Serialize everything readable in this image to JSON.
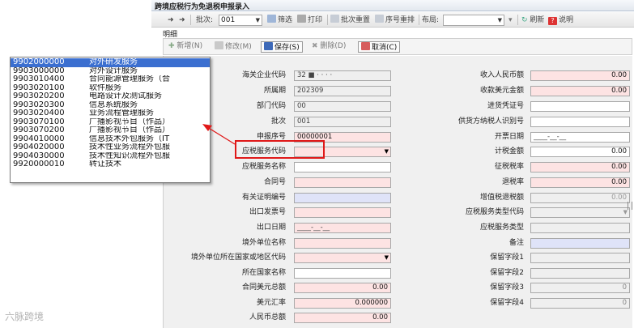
{
  "window": {
    "title": "跨境应税行为免退税申报录入"
  },
  "toolbar": {
    "batch_label": "批次:",
    "batch_value": "001",
    "filter": "筛选",
    "print": "打印",
    "batch_reset": "批次重置",
    "seq_reset": "序号重排",
    "layout_label": "布局:",
    "refresh": "刷新",
    "help": "说明"
  },
  "section": {
    "title": "明细"
  },
  "detail_toolbar": {
    "add": "新增(N)",
    "edit": "修改(M)",
    "save": "保存(S)",
    "delete": "删除(D)",
    "cancel": "取消(C)"
  },
  "left_fields": [
    {
      "label": "海关企业代码",
      "value": "32 ■ · · · ·"
    },
    {
      "label": "所属期",
      "value": "202309"
    },
    {
      "label": "部门代码",
      "value": "00"
    },
    {
      "label": "批次",
      "value": "001"
    },
    {
      "label": "申报序号",
      "value": "00000001"
    },
    {
      "label": "应税服务代码",
      "value": ""
    },
    {
      "label": "应税服务名称",
      "value": ""
    },
    {
      "label": "合同号",
      "value": ""
    },
    {
      "label": "有关证明编号",
      "value": ""
    },
    {
      "label": "出口发票号",
      "value": ""
    },
    {
      "label": "出口日期",
      "value": "____-__-__"
    },
    {
      "label": "境外单位名称",
      "value": ""
    },
    {
      "label": "境外单位所在国家或地区代码",
      "value": ""
    },
    {
      "label": "所在国家名称",
      "value": ""
    },
    {
      "label": "合同美元总额",
      "value": "0.00"
    },
    {
      "label": "美元汇率",
      "value": "0.000000"
    },
    {
      "label": "人民币总额",
      "value": "0.00"
    }
  ],
  "right_fields": [
    {
      "label": "收入人民币额",
      "value": "0.00"
    },
    {
      "label": "收款美元金额",
      "value": "0.00"
    },
    {
      "label": "进货凭证号",
      "value": ""
    },
    {
      "label": "供货方纳税人识别号",
      "value": ""
    },
    {
      "label": "开票日期",
      "value": "____-__-__"
    },
    {
      "label": "计税金额",
      "value": "0.00"
    },
    {
      "label": "征税税率",
      "value": "0.00"
    },
    {
      "label": "退税率",
      "value": "0.00"
    },
    {
      "label": "增值税退税额",
      "value": "0.00"
    },
    {
      "label": "应税服务类型代码",
      "value": ""
    },
    {
      "label": "应税服务类型",
      "value": ""
    },
    {
      "label": "备注",
      "value": ""
    },
    {
      "label": "保留字段1",
      "value": ""
    },
    {
      "label": "保留字段2",
      "value": ""
    },
    {
      "label": "保留字段3",
      "value": "0"
    },
    {
      "label": "保留字段4",
      "value": "0"
    }
  ],
  "dropdown": {
    "options": [
      {
        "code": "9902000000",
        "name": "对外研发服务"
      },
      {
        "code": "9903000000",
        "name": "对外设计服务"
      },
      {
        "code": "9903010400",
        "name": "合同能源管理服务（合"
      },
      {
        "code": "9903020100",
        "name": "软件服务"
      },
      {
        "code": "9903020200",
        "name": "电路设计及测试服务"
      },
      {
        "code": "9903020300",
        "name": "信息系统服务"
      },
      {
        "code": "9903020400",
        "name": "业务流程管理服务"
      },
      {
        "code": "9903070100",
        "name": "广播影视节目（作品）"
      },
      {
        "code": "9903070200",
        "name": "广播影视节目（作品）"
      },
      {
        "code": "9904010000",
        "name": "信息技术外包服务（IT"
      },
      {
        "code": "9904020000",
        "name": "技术性业务流程外包服"
      },
      {
        "code": "9904030000",
        "name": "技术性知识流程外包服"
      },
      {
        "code": "9920000010",
        "name": "转让技术"
      }
    ]
  },
  "watermark": "六脉跨境",
  "colors": {
    "required": "#fde3e3",
    "optional": "#dfe3f8",
    "selected": "#3b6fd0",
    "highlight": "#e01818"
  }
}
